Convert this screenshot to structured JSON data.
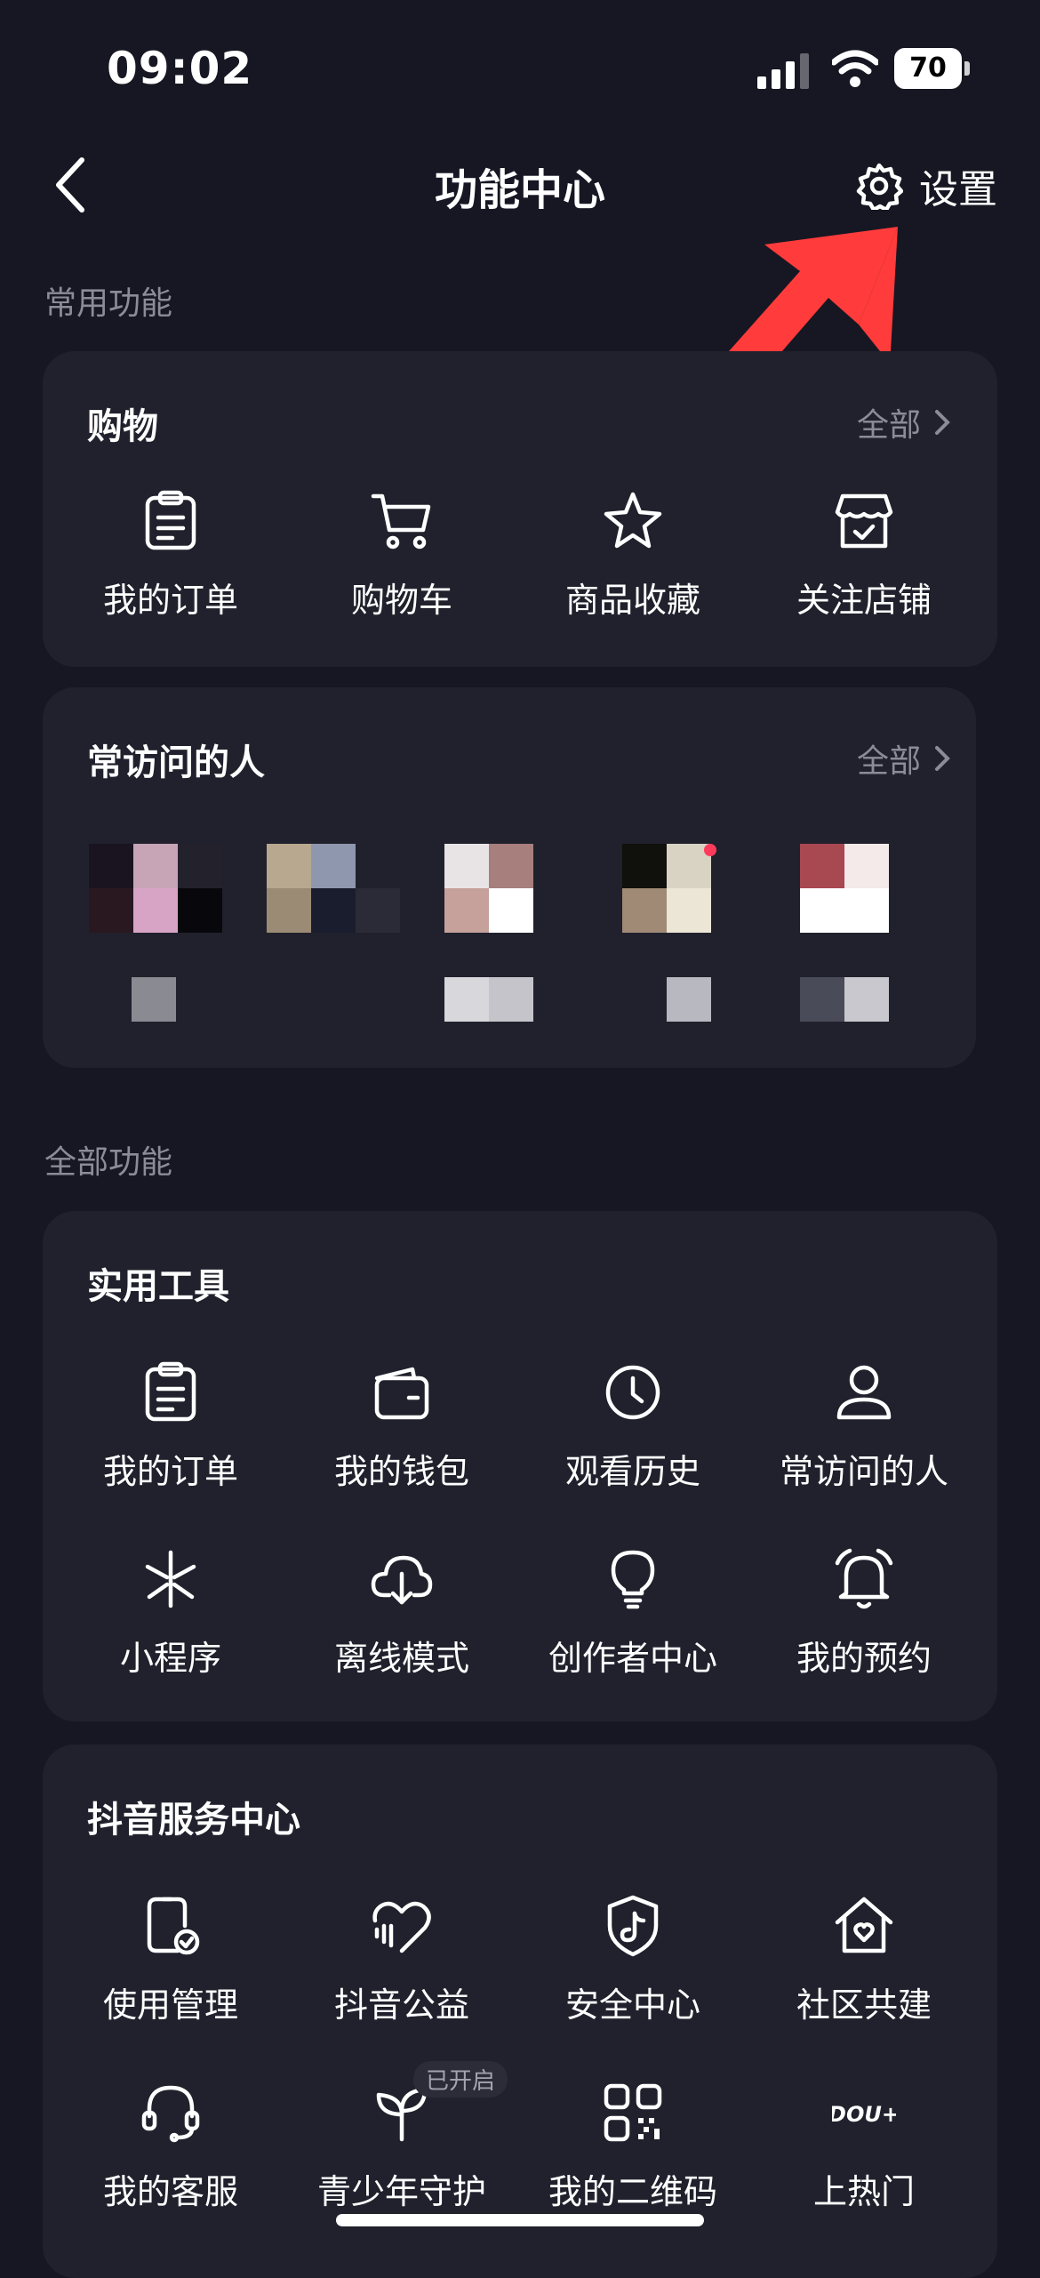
{
  "status_bar": {
    "time": "09:02",
    "battery_level": "70"
  },
  "nav": {
    "title": "功能中心",
    "settings_label": "设置"
  },
  "sections": {
    "common": "常用功能",
    "all": "全部功能"
  },
  "shopping": {
    "title": "购物",
    "more": "全部",
    "items": [
      {
        "label": "我的订单",
        "icon": "order-icon"
      },
      {
        "label": "购物车",
        "icon": "cart-icon"
      },
      {
        "label": "商品收藏",
        "icon": "star-icon"
      },
      {
        "label": "关注店铺",
        "icon": "store-icon"
      }
    ]
  },
  "frequent": {
    "title": "常访问的人",
    "more": "全部"
  },
  "tools": {
    "title": "实用工具",
    "items": [
      {
        "label": "我的订单",
        "icon": "order-icon"
      },
      {
        "label": "我的钱包",
        "icon": "wallet-icon"
      },
      {
        "label": "观看历史",
        "icon": "clock-icon"
      },
      {
        "label": "常访问的人",
        "icon": "person-icon"
      },
      {
        "label": "小程序",
        "icon": "mini-program-icon"
      },
      {
        "label": "离线模式",
        "icon": "cloud-download-icon"
      },
      {
        "label": "创作者中心",
        "icon": "lightbulb-icon"
      },
      {
        "label": "我的预约",
        "icon": "bell-icon"
      }
    ]
  },
  "services": {
    "title": "抖音服务中心",
    "badge": "已开启",
    "items": [
      {
        "label": "使用管理",
        "icon": "phone-check-icon"
      },
      {
        "label": "抖音公益",
        "icon": "heart-icon"
      },
      {
        "label": "安全中心",
        "icon": "shield-icon"
      },
      {
        "label": "社区共建",
        "icon": "house-heart-icon"
      },
      {
        "label": "我的客服",
        "icon": "headset-icon"
      },
      {
        "label": "青少年守护",
        "icon": "sprout-icon"
      },
      {
        "label": "我的二维码",
        "icon": "qrcode-icon"
      },
      {
        "label": "上热门",
        "icon": "dou-plus-icon",
        "text": "DOU+"
      }
    ]
  },
  "colors": {
    "background": "#161722",
    "card": "#20212c",
    "muted": "#8b8c96",
    "annotation": "#ff3b3b"
  }
}
